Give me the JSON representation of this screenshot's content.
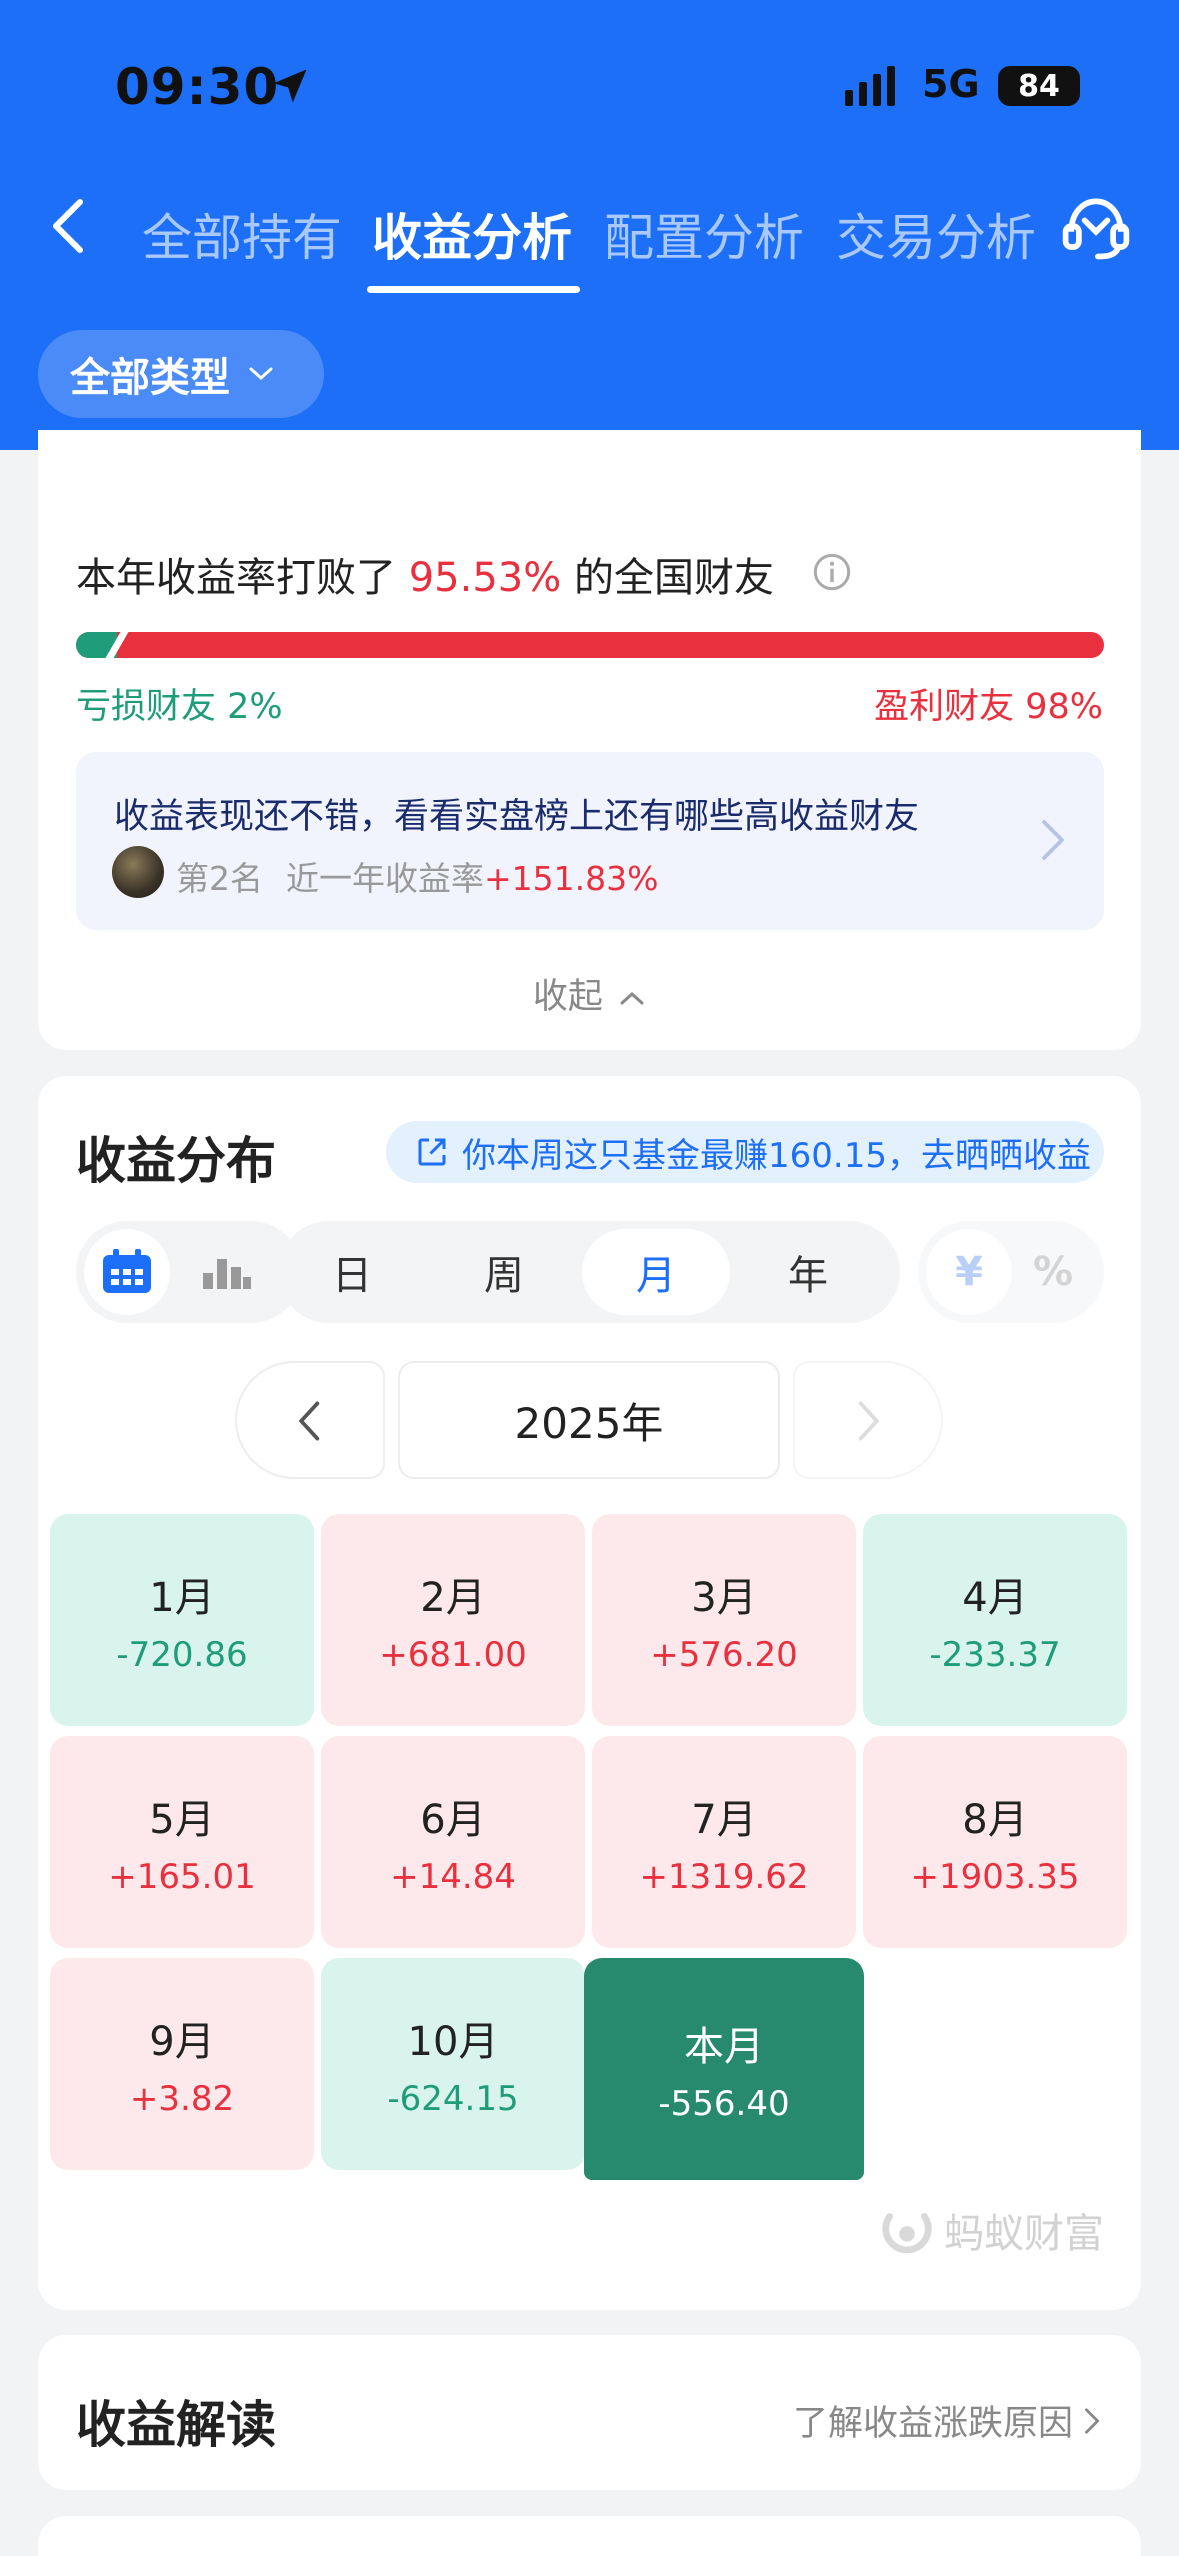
{
  "status": {
    "time": "09:30",
    "network": "5G",
    "battery": "84"
  },
  "tabs": [
    {
      "label": "全部持有",
      "active": false
    },
    {
      "label": "收益分析",
      "active": true
    },
    {
      "label": "配置分析",
      "active": false
    },
    {
      "label": "交易分析",
      "active": false
    }
  ],
  "filter": {
    "label": "全部类型"
  },
  "ranking": {
    "prefix": "本年收益率打败了",
    "percent": "95.53%",
    "suffix": "的全国财友",
    "loss_label": "亏损财友 2%",
    "profit_label": "盈利财友 98%",
    "loss_share": 0.02
  },
  "promo": {
    "title": "收益表现还不错，看看实盘榜上还有哪些高收益财友",
    "rank": "第2名",
    "rate_label": "近一年收益率",
    "rate_value": "+151.83%"
  },
  "collapse_label": "收起",
  "distribution": {
    "title": "收益分布",
    "share_text": "你本周这只基金最赚160.15，去晒晒收益",
    "periods": [
      "日",
      "周",
      "月",
      "年"
    ],
    "active_period": "月",
    "units": [
      "¥",
      "%"
    ],
    "year": "2025年",
    "months": [
      {
        "name": "1月",
        "value": "-720.86",
        "trend": "down"
      },
      {
        "name": "2月",
        "value": "+681.00",
        "trend": "up"
      },
      {
        "name": "3月",
        "value": "+576.20",
        "trend": "up"
      },
      {
        "name": "4月",
        "value": "-233.37",
        "trend": "down"
      },
      {
        "name": "5月",
        "value": "+165.01",
        "trend": "up"
      },
      {
        "name": "6月",
        "value": "+14.84",
        "trend": "up"
      },
      {
        "name": "7月",
        "value": "+1319.62",
        "trend": "up"
      },
      {
        "name": "8月",
        "value": "+1903.35",
        "trend": "up"
      },
      {
        "name": "9月",
        "value": "+3.82",
        "trend": "up"
      },
      {
        "name": "10月",
        "value": "-624.15",
        "trend": "down"
      },
      {
        "name": "本月",
        "value": "-556.40",
        "trend": "current"
      }
    ],
    "brand": "蚂蚁财富"
  },
  "interpretation": {
    "title": "收益解读",
    "link": "了解收益涨跌原因"
  },
  "colors": {
    "primary": "#1d6ff7",
    "up": "#e8303e",
    "down": "#1f9d7a",
    "current": "#278a6c"
  }
}
